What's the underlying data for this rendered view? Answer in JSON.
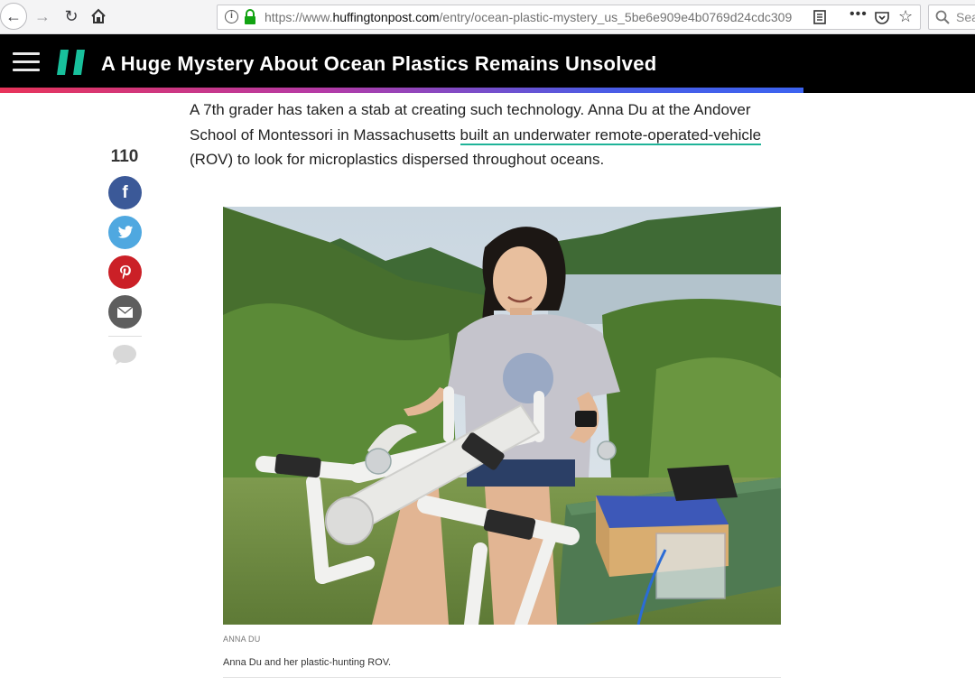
{
  "browser": {
    "url_prefix": "https://www.",
    "url_host": "huffingtonpost.com",
    "url_path": "/entry/ocean-plastic-mystery_us_5be6e909e4b0769d24cdc309",
    "search_placeholder": "Sea",
    "icons": [
      "back-icon",
      "forward-icon",
      "reload-icon",
      "home-icon",
      "info-icon",
      "lock-icon",
      "reader-view-icon",
      "more-icon",
      "pocket-icon",
      "bookmark-star-icon",
      "search-icon"
    ]
  },
  "site": {
    "headline": "A Huge Mystery About Ocean Plastics Remains Unsolved",
    "logo_color": "#18c09c"
  },
  "share": {
    "count": "110",
    "buttons": [
      {
        "name": "facebook",
        "glyph": "f",
        "color": "#3b5998"
      },
      {
        "name": "twitter",
        "color": "#4fa8e0"
      },
      {
        "name": "pinterest",
        "color": "#cb2027"
      },
      {
        "name": "email",
        "color": "#5e5e5e"
      }
    ]
  },
  "article": {
    "text_before": "A 7th grader has taken a stab at creating such technology. Anna Du at the Andover School of Montessori in Massachusetts ",
    "link_text": "built an underwater remote-operated-vehicle",
    "text_after": " (ROV) to look for microplastics dispersed throughout oceans.",
    "link_underline_color": "#1fb398"
  },
  "photo": {
    "credit": "ANNA DU",
    "caption": "Anna Du and her plastic-hunting ROV."
  }
}
